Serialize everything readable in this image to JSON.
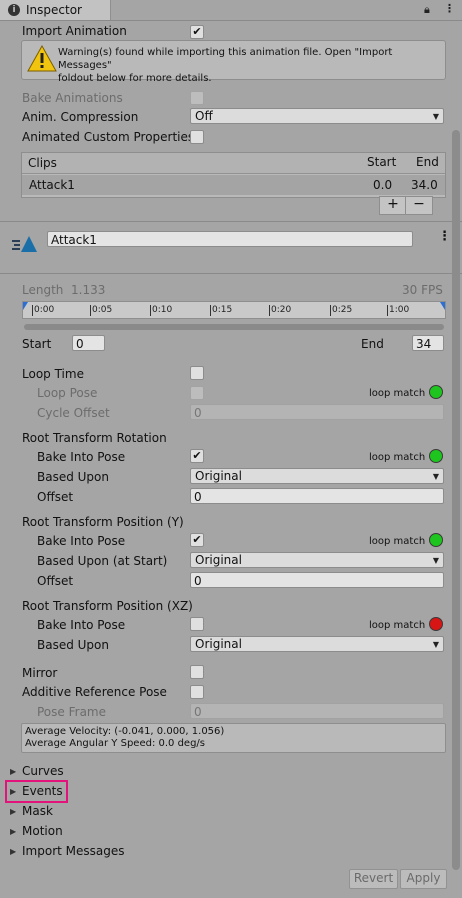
{
  "window": {
    "tab_title": "Inspector",
    "tab_icon": "info-icon",
    "lock_icon": "lock-icon",
    "menu_icon": "kebab-menu-icon"
  },
  "import": {
    "import_animation_label": "Import Animation",
    "import_animation_checked": "✔",
    "warning_text_line1": "Warning(s) found while importing this animation file. Open \"Import Messages\"",
    "warning_text_line2": "foldout below for more details.",
    "bake_animations_label": "Bake Animations",
    "anim_compression_label": "Anim. Compression",
    "anim_compression_value": "Off",
    "animated_custom_properties_label": "Animated Custom Properties"
  },
  "clips": {
    "header_clips": "Clips",
    "header_start": "Start",
    "header_end": "End",
    "rows": [
      {
        "name": "Attack1",
        "start": "0.0",
        "end": "34.0"
      }
    ],
    "add_label": "+",
    "remove_label": "−"
  },
  "clip": {
    "name_value": "Attack1",
    "length_label": "Length",
    "length_value": "1.133",
    "fps": "30 FPS",
    "ticks": [
      "0:00",
      "0:05",
      "0:10",
      "0:15",
      "0:20",
      "0:25",
      "1:00"
    ],
    "start_label": "Start",
    "start_value": "0",
    "end_label": "End",
    "end_value": "34"
  },
  "loop": {
    "loop_time_label": "Loop Time",
    "loop_pose_label": "Loop Pose",
    "cycle_offset_label": "Cycle Offset",
    "cycle_offset_value": "0",
    "loop_match": "loop match"
  },
  "rotation": {
    "title": "Root Transform Rotation",
    "bake_label": "Bake Into Pose",
    "bake_checked": "✔",
    "based_upon_label": "Based Upon",
    "based_upon_value": "Original",
    "offset_label": "Offset",
    "offset_value": "0"
  },
  "position_y": {
    "title": "Root Transform Position (Y)",
    "bake_label": "Bake Into Pose",
    "bake_checked": "✔",
    "based_upon_label": "Based Upon (at Start)",
    "based_upon_value": "Original",
    "offset_label": "Offset",
    "offset_value": "0"
  },
  "position_xz": {
    "title": "Root Transform Position (XZ)",
    "bake_label": "Bake Into Pose",
    "based_upon_label": "Based Upon",
    "based_upon_value": "Original"
  },
  "misc": {
    "mirror_label": "Mirror",
    "additive_label": "Additive Reference Pose",
    "pose_frame_label": "Pose Frame",
    "pose_frame_value": "0",
    "avg_velocity": "Average Velocity: (-0.041, 0.000, 1.056)",
    "avg_angular": "Average Angular Y Speed: 0.0 deg/s"
  },
  "foldouts": [
    "Curves",
    "Events",
    "Mask",
    "Motion",
    "Import Messages"
  ],
  "footer": {
    "revert_label": "Revert",
    "apply_label": "Apply"
  },
  "colors": {
    "loop_match_ok": "#1ec51e",
    "loop_match_bad": "#d81515",
    "highlight": "#e2137a"
  }
}
